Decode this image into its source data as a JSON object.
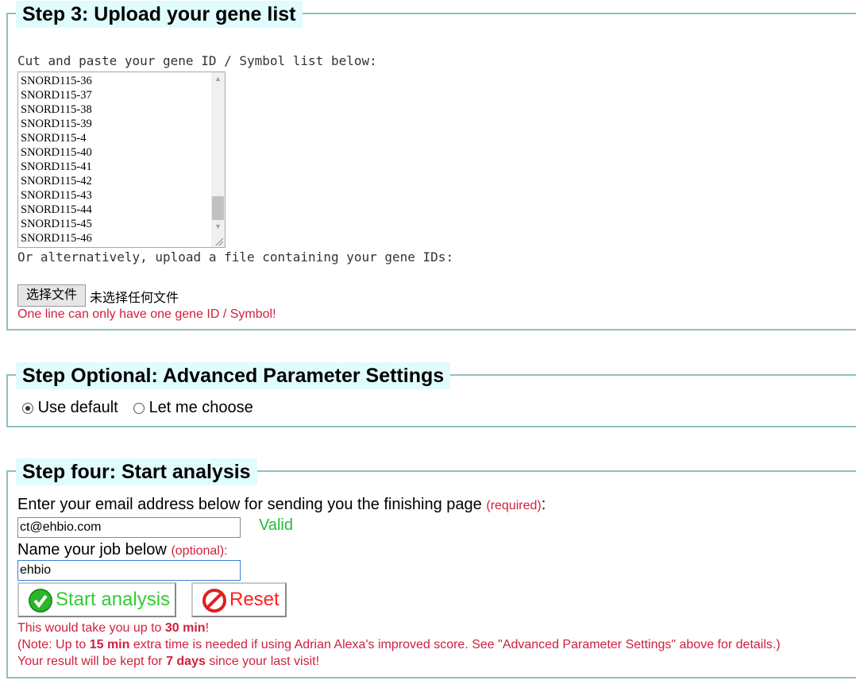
{
  "step3": {
    "legend": "Step 3: Upload your gene list",
    "paste_label": "Cut and paste your gene ID / Symbol list below:",
    "gene_list": [
      "SNORD115-36",
      "SNORD115-37",
      "SNORD115-38",
      "SNORD115-39",
      "SNORD115-4",
      "SNORD115-40",
      "SNORD115-41",
      "SNORD115-42",
      "SNORD115-43",
      "SNORD115-44",
      "SNORD115-45",
      "SNORD115-46"
    ],
    "upload_label": "Or alternatively, upload a file containing your gene IDs:",
    "file_button": "选择文件",
    "file_status": "未选择任何文件",
    "warning": "One line can only have one gene ID / Symbol!"
  },
  "step_optional": {
    "legend": "Step Optional: Advanced Parameter Settings",
    "option_default": "Use default",
    "option_choose": "Let me choose",
    "selected": "Use default"
  },
  "step4": {
    "legend": "Step four: Start analysis",
    "email_label": "Enter your email address below for sending you the finishing page",
    "email_required": "(required)",
    "email_colon": ":",
    "email_value": "ct@ehbio.com",
    "email_valid": "Valid",
    "job_label": "Name your job below",
    "job_optional": "(optional):",
    "job_value": "ehbio",
    "start_button": "Start analysis",
    "reset_button": "Reset",
    "note1_pre": "This would take you up to ",
    "note1_bold": "30 min",
    "note1_post": "!",
    "note2_pre": "(Note: Up to ",
    "note2_bold": "15 min",
    "note2_post": " extra time is needed if using Adrian Alexa's improved score. See \"Advanced Parameter Settings\" above for details.)",
    "note3_pre": "Your result will be kept for ",
    "note3_bold": "7 days",
    "note3_post": " since your last visit!"
  },
  "colors": {
    "border": "#8fc0c0",
    "legend_bg": "#e0fcfc",
    "red_text": "#d0203c",
    "valid_green": "#22bb33",
    "start_green": "#33cc33",
    "reset_red": "#ff2020"
  }
}
